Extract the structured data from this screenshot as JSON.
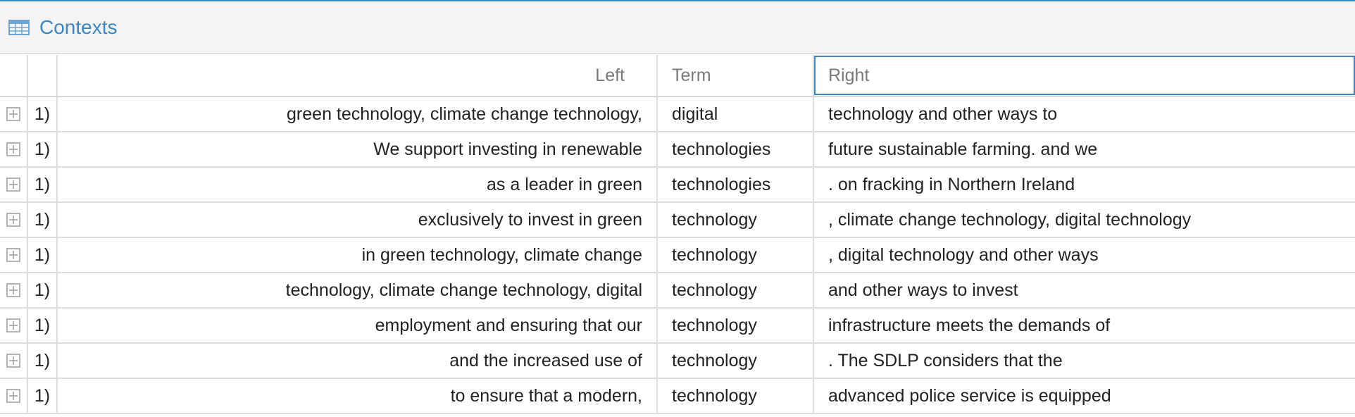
{
  "panel": {
    "title": "Contexts",
    "icon": "table-icon",
    "accent_color": "#3a87c8"
  },
  "columns": {
    "left": "Left",
    "term": "Term",
    "right": "Right"
  },
  "rows": [
    {
      "num": "1)",
      "left": "green technology, climate change technology,",
      "term": "digital",
      "right": "technology and other ways to"
    },
    {
      "num": "1)",
      "left": "We support investing in renewable",
      "term": "technologies",
      "right": "future sustainable farming. and we"
    },
    {
      "num": "1)",
      "left": "as a leader in green",
      "term": "technologies",
      "right": ". on fracking in Northern Ireland"
    },
    {
      "num": "1)",
      "left": "exclusively to invest in green",
      "term": "technology",
      "right": ", climate change technology, digital technology"
    },
    {
      "num": "1)",
      "left": "in green technology, climate change",
      "term": "technology",
      "right": ", digital technology and other ways"
    },
    {
      "num": "1)",
      "left": "technology, climate change technology, digital",
      "term": "technology",
      "right": "and other ways to invest"
    },
    {
      "num": "1)",
      "left": "employment and ensuring that our",
      "term": "technology",
      "right": "infrastructure meets the demands of"
    },
    {
      "num": "1)",
      "left": "and the increased use of",
      "term": "technology",
      "right": ". The SDLP considers that the"
    },
    {
      "num": "1)",
      "left": "to ensure that a modern,",
      "term": "technology",
      "right": "advanced police service is equipped"
    }
  ]
}
